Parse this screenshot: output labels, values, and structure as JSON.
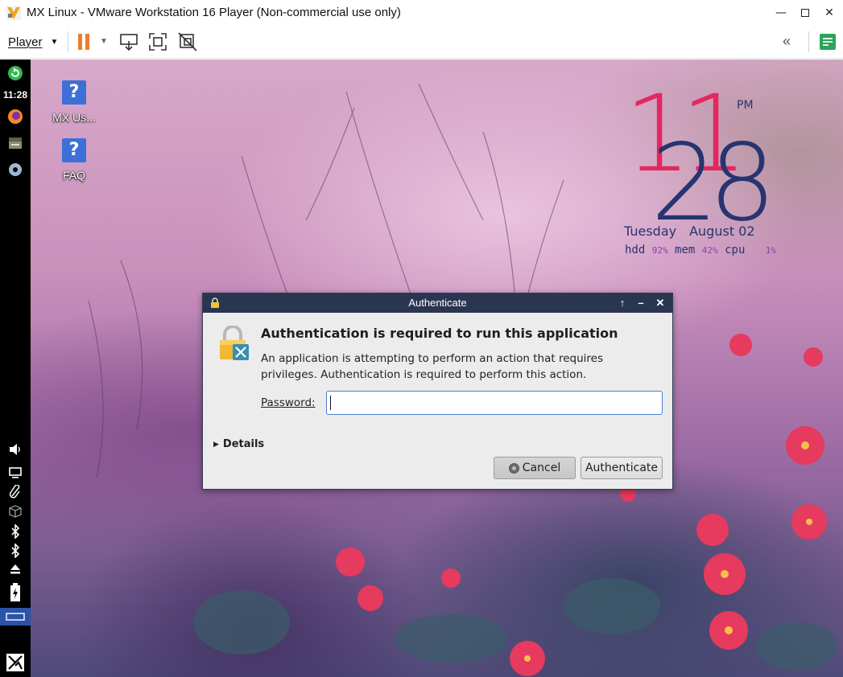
{
  "window": {
    "title": "MX Linux - VMware Workstation 16 Player (Non-commercial use only)",
    "minimize_icon": "minimize-icon",
    "maximize_icon": "maximize-icon",
    "close_icon": "close-icon"
  },
  "toolbar": {
    "player_label": "Player",
    "icons": [
      "pause-icon",
      "send-ctrl-alt-del-icon",
      "fullscreen-icon",
      "unity-icon",
      "collapse-icon",
      "notes-icon"
    ],
    "pause_color": "#f07d2b",
    "notes_color": "#2aa55a"
  },
  "panel": {
    "clock": "11:28",
    "icons": [
      "update-icon",
      "firefox-icon",
      "file-manager-icon",
      "settings-icon",
      "volume-icon",
      "display-icon",
      "clipboard-icon",
      "package-icon",
      "bluetooth-icon",
      "bluetooth-icon",
      "eject-icon",
      "battery-icon",
      "workspace-icon",
      "mx-logo-icon"
    ]
  },
  "desktop_icons": [
    {
      "label": "MX Us..."
    },
    {
      "label": "FAQ"
    }
  ],
  "conky": {
    "hour": "11",
    "minute": "28",
    "ampm": "PM",
    "day": "Tuesday",
    "date": "August 02",
    "hdd_label": "hdd",
    "hdd_value": "92%",
    "mem_label": "mem",
    "mem_value": "42%",
    "cpu_label": "cpu",
    "cpu_value": "1%",
    "colors": {
      "hour": "#e3275f",
      "minute": "#27346f",
      "percent": "#8a3fb0"
    }
  },
  "dialog": {
    "title": "Authenticate",
    "heading": "Authentication is required to run this application",
    "message": "An application is attempting to perform an action that requires privileges. Authentication is required to perform this action.",
    "password_label": "Password:",
    "password_value": "",
    "details_label": "Details",
    "cancel_label": "Cancel",
    "authenticate_label": "Authenticate",
    "titlebar_color": "#2a3650"
  }
}
